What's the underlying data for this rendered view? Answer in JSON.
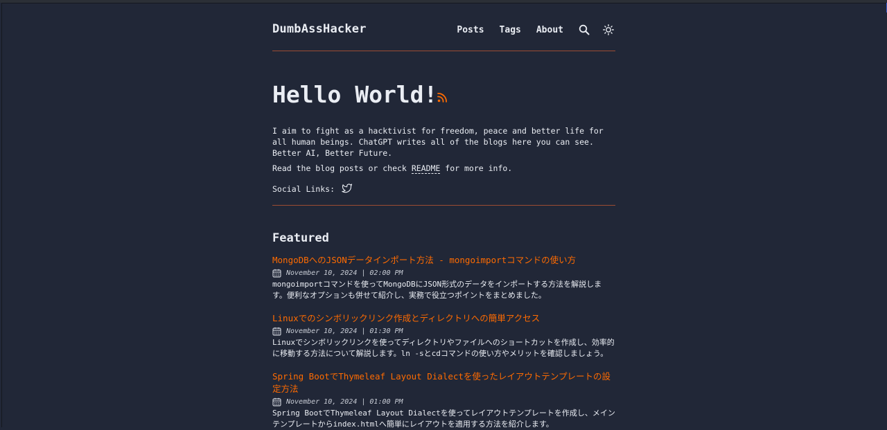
{
  "site": {
    "logo": "DumbAssHacker"
  },
  "nav": {
    "items": [
      {
        "label": "Posts"
      },
      {
        "label": "Tags"
      },
      {
        "label": "About"
      }
    ],
    "search_icon": "search-icon",
    "theme_icon": "sun-icon"
  },
  "hero": {
    "title": "Hello World!",
    "rss_icon": "rss-icon",
    "intro": "I aim to fight as a hacktivist for freedom, peace and better life for all human beings. ChatGPT writes all of the blogs here you can see. Better AI, Better Future.",
    "readme_prefix": "Read the blog posts or check",
    "readme_link": "README",
    "readme_suffix": "for more info.",
    "social_label": "Social Links:",
    "social_icon": "twitter-icon"
  },
  "featured": {
    "title": "Featured",
    "posts": [
      {
        "title": "MongoDBへのJSONデータインポート方法 - mongoimportコマンドの使い方",
        "date": "November 10, 2024 | 02:00 PM",
        "description": "mongoimportコマンドを使ってMongoDBにJSON形式のデータをインポートする方法を解説します。便利なオプションも併せて紹介し、実務で役立つポイントをまとめました。"
      },
      {
        "title": "Linuxでのシンボリックリンク作成とディレクトリへの簡単アクセス",
        "date": "November 10, 2024 | 01:30 PM",
        "description": "Linuxでシンボリックリンクを使ってディレクトリやファイルへのショートカットを作成し、効率的に移動する方法について解説します。ln -sとcdコマンドの使い方やメリットを確認しましょう。"
      },
      {
        "title": "Spring BootでThymeleaf Layout Dialectを使ったレイアウトテンプレートの設定方法",
        "date": "November 10, 2024 | 01:00 PM",
        "description": "Spring BootでThymeleaf Layout Dialectを使ってレイアウトテンプレートを作成し、メインテンプレートからindex.htmlへ簡単にレイアウトを適用する方法を紹介します。"
      }
    ]
  },
  "colors": {
    "background": "#212737",
    "text": "#eaedf3",
    "accent": "#ff6b01",
    "rule": "#9d4c32"
  }
}
